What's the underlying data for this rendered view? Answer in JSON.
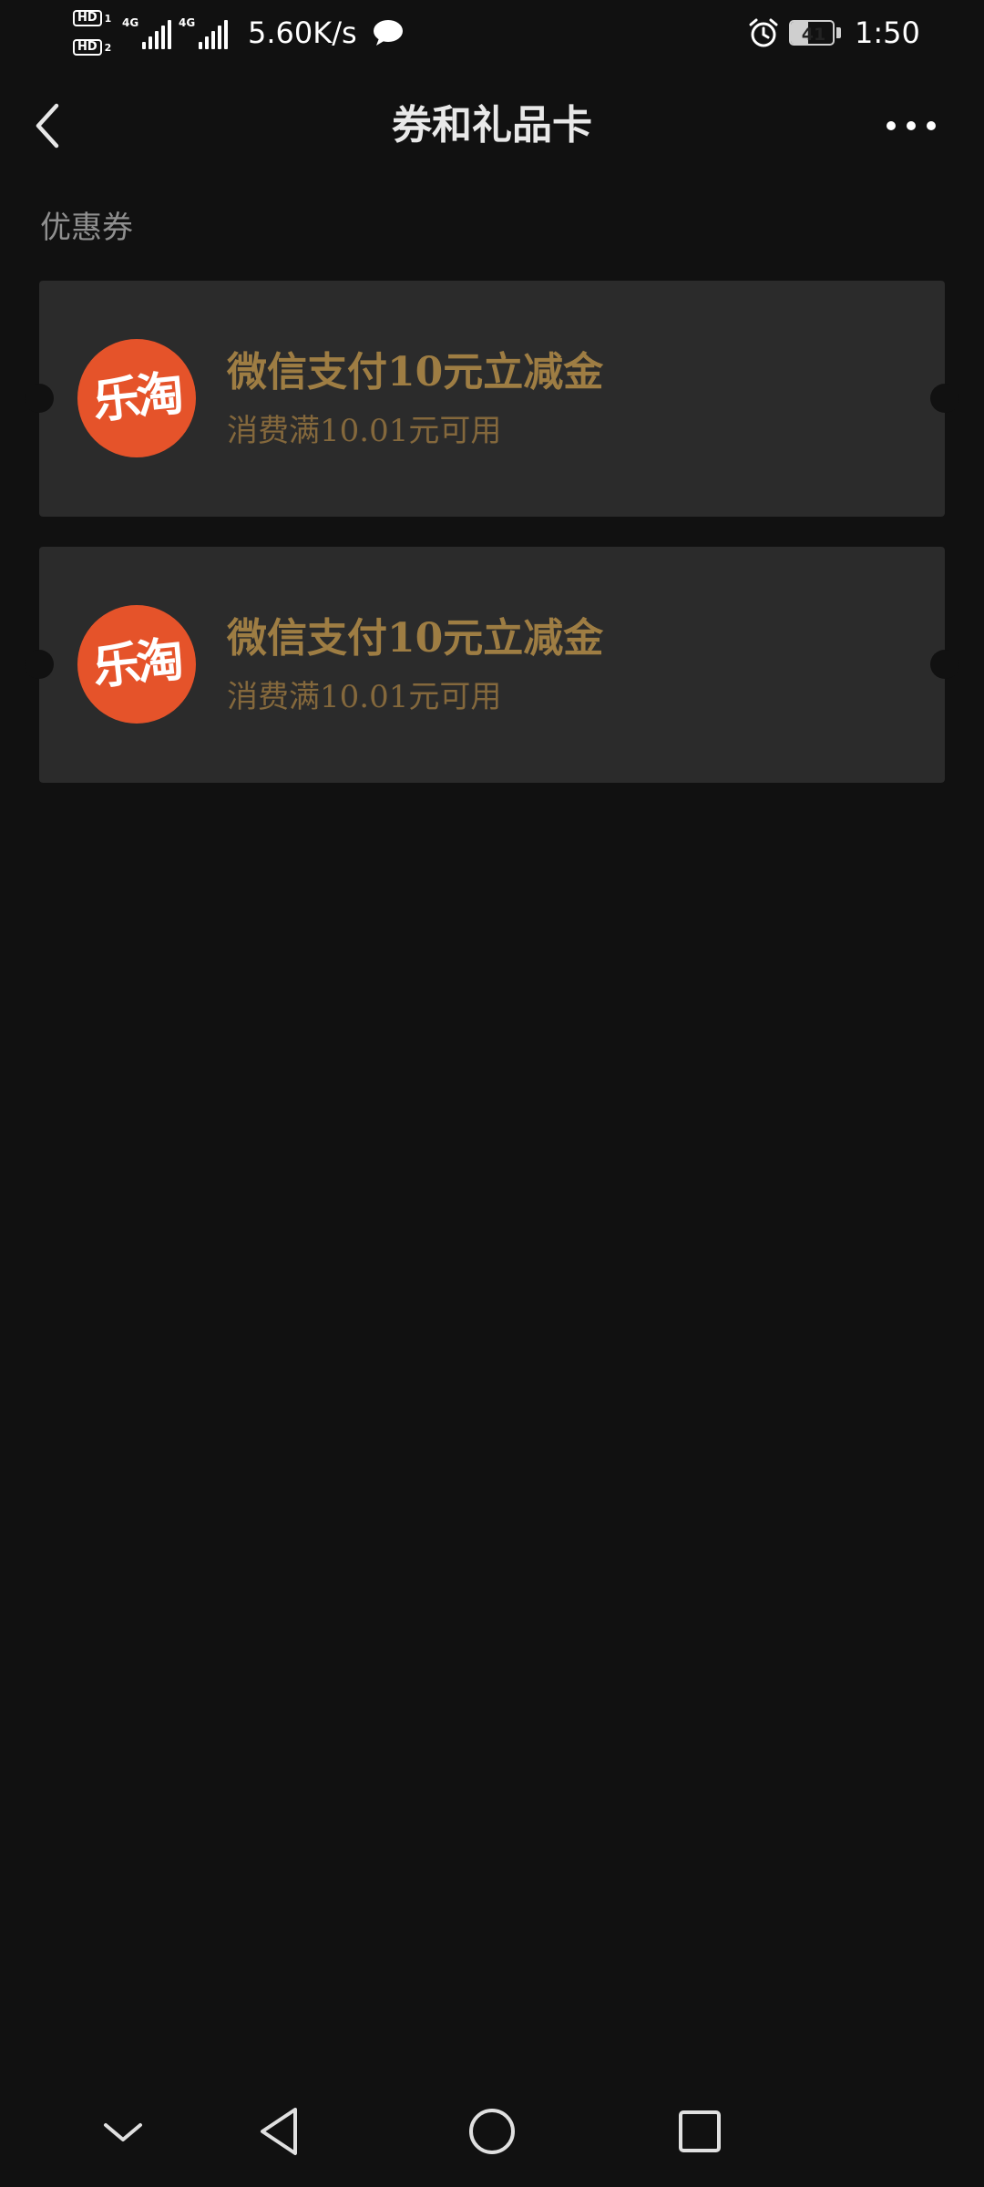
{
  "status_bar": {
    "hd1_label": "HD",
    "hd1_num": "1",
    "hd2_label": "HD",
    "hd2_num": "2",
    "signal1_tag": "4G",
    "signal2_tag": "4G",
    "net_speed": "5.60K/s",
    "battery_level": "41",
    "battery_fraction": 0.41,
    "time": "1:50",
    "icons": [
      "chat-bubble-icon",
      "alarm-icon",
      "battery-icon"
    ]
  },
  "header": {
    "title": "券和礼品卡",
    "back_icon": "chevron-left-icon",
    "more_icon": "more-dots-icon"
  },
  "section": {
    "label": "优惠券"
  },
  "coupons": [
    {
      "logo_text": "乐淘",
      "title": "微信支付10元立减金",
      "condition": "消费满10.01元可用"
    },
    {
      "logo_text": "乐淘",
      "title": "微信支付10元立减金",
      "condition": "消费满10.01元可用"
    }
  ],
  "colors": {
    "background": "#111111",
    "card": "#2b2b2b",
    "coupon_title": "#9e7d43",
    "coupon_condition": "#84683c",
    "logo_bg": "#e5532a"
  },
  "nav_bar": {
    "icons": [
      "chevron-down-icon",
      "triangle-back-icon",
      "circle-home-icon",
      "square-recent-icon"
    ]
  }
}
